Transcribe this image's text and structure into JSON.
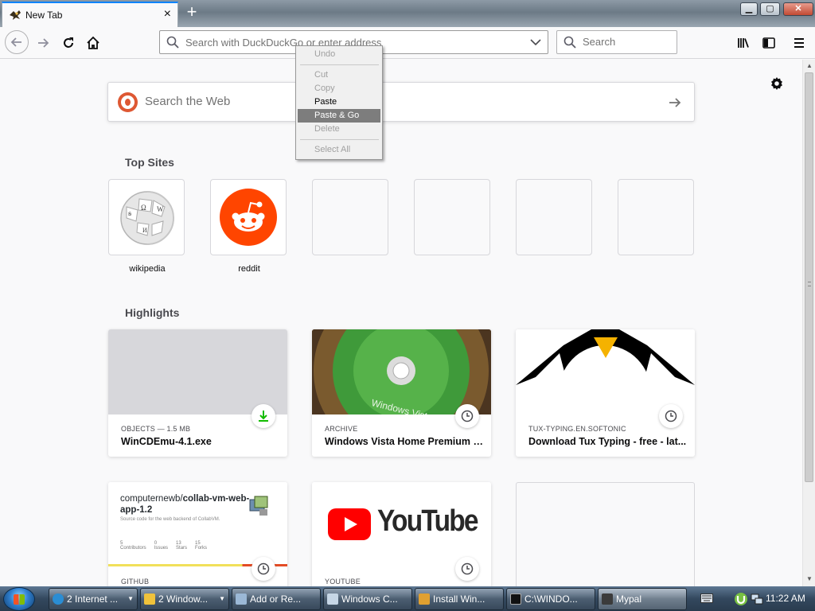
{
  "browser": {
    "tab_title": "New Tab",
    "close_tab_symbol": "×",
    "new_tab_symbol": "+",
    "window_buttons": {
      "minimize": "▁",
      "maximize": "▢",
      "close": "✕"
    },
    "url_placeholder": "Search with DuckDuckGo or enter address",
    "search_placeholder": "Search",
    "accent_color": "#0a84ff"
  },
  "newtab": {
    "web_search_placeholder": "Search the Web",
    "top_sites_heading": "Top Sites",
    "highlights_heading": "Highlights",
    "top_sites": [
      {
        "label": "wikipedia",
        "icon": "wikipedia-globe-icon"
      },
      {
        "label": "reddit",
        "icon": "reddit-alien-icon",
        "color": "#ff4500"
      },
      {
        "label": ""
      },
      {
        "label": ""
      },
      {
        "label": ""
      },
      {
        "label": ""
      }
    ],
    "highlights": [
      {
        "context": "OBJECTS — 1.5 MB",
        "title": "WinCDEmu-4.1.exe",
        "badge": "download-icon"
      },
      {
        "context": "ARCHIVE",
        "title": "Windows Vista Home Premium (...",
        "badge": "clock-icon",
        "thumb_text": "Windows Vista"
      },
      {
        "context": "TUX-TYPING.EN.SOFTONIC",
        "title": "Download Tux Typing - free - lat...",
        "badge": "clock-icon"
      },
      {
        "context": "GITHUB",
        "title": "",
        "badge": "clock-icon",
        "thumb": {
          "repo_owner": "computernewb/",
          "repo_name": "collab-vm-web-app-1.2",
          "description": "Source code for the web backend of CollabVM.",
          "stats": [
            {
              "v": "5",
              "l": "Contributors"
            },
            {
              "v": "0",
              "l": "Issues"
            },
            {
              "v": "13",
              "l": "Stars"
            },
            {
              "v": "15",
              "l": "Forks"
            }
          ]
        }
      },
      {
        "context": "YOUTUBE",
        "title": "",
        "badge": "clock-icon",
        "thumb_text": "YouTube"
      },
      {
        "context": "",
        "title": ""
      }
    ]
  },
  "context_menu": {
    "items": [
      {
        "label": "Undo",
        "disabled": true
      },
      {
        "label": "Cut",
        "disabled": true
      },
      {
        "label": "Copy",
        "disabled": true
      },
      {
        "label": "Paste",
        "disabled": false
      },
      {
        "label": "Paste & Go",
        "disabled": false,
        "highlighted": true
      },
      {
        "label": "Delete",
        "disabled": true
      },
      {
        "label": "Select All",
        "disabled": true
      }
    ]
  },
  "taskbar": {
    "items": [
      {
        "label": "2 Internet ...",
        "icon": "ie-icon",
        "color": "#2a8dd4"
      },
      {
        "label": "2 Window...",
        "icon": "folder-icon",
        "color": "#f0c23b"
      },
      {
        "label": "Add or Re...",
        "icon": "control-panel-icon",
        "color": "#9bb8d6"
      },
      {
        "label": "Windows C...",
        "icon": "windows-component-icon",
        "color": "#c6d6e6"
      },
      {
        "label": "Install Win...",
        "icon": "installer-icon",
        "color": "#e0a030"
      },
      {
        "label": "C:\\WINDO...",
        "icon": "cmd-icon",
        "color": "#111111"
      },
      {
        "label": "Mypal",
        "icon": "mypal-icon",
        "color": "#3b3b3b"
      }
    ],
    "clock": "11:22 AM"
  }
}
